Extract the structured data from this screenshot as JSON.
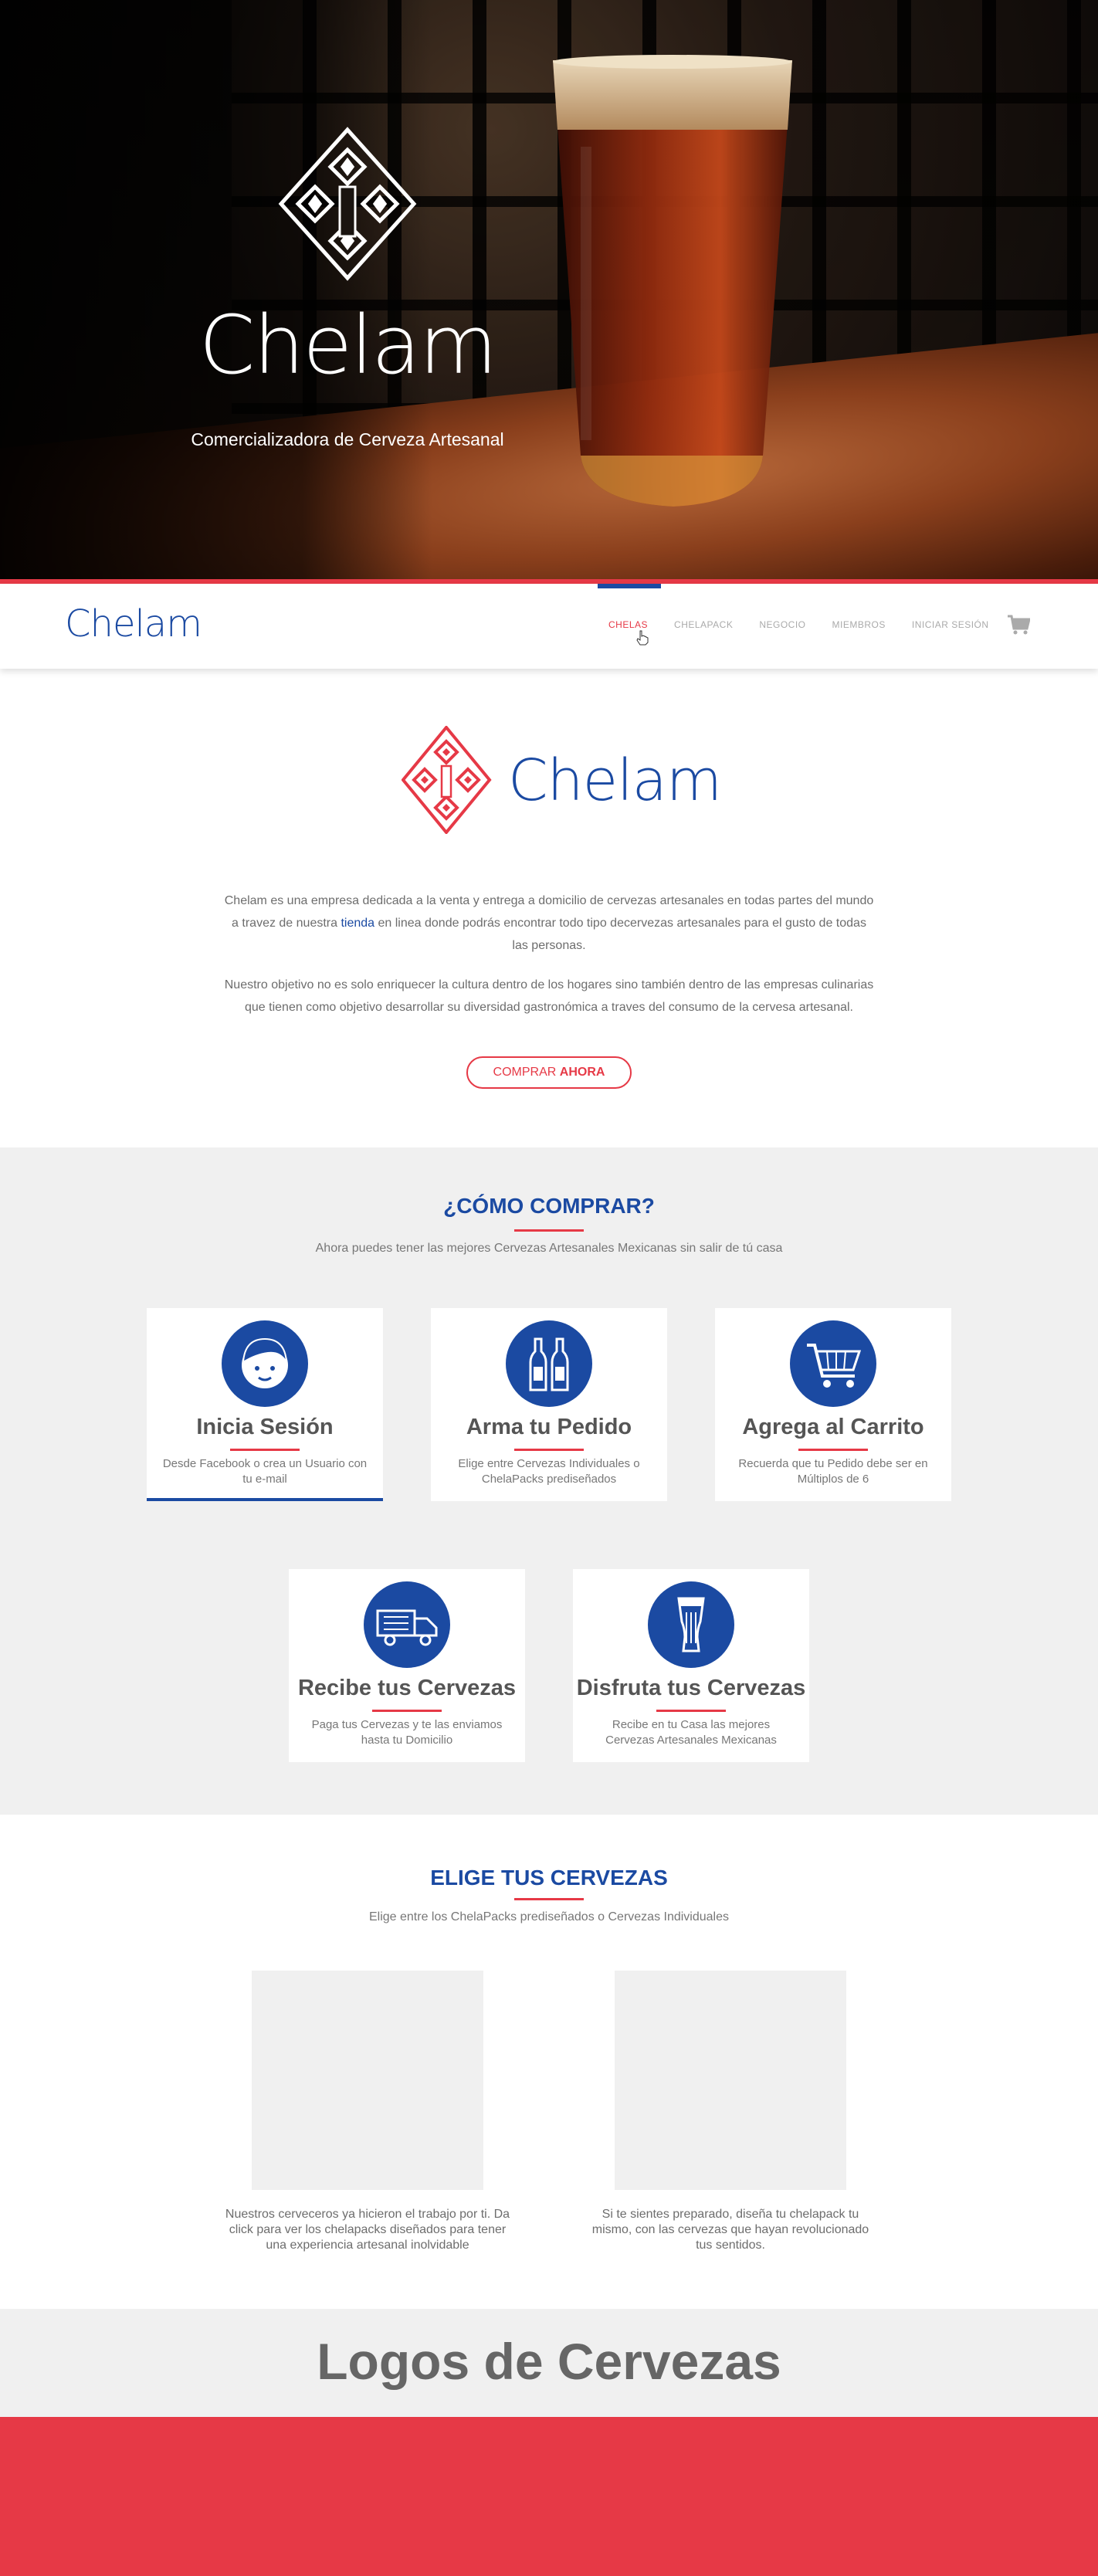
{
  "hero": {
    "brand": "Chelam",
    "tagline": "Comercializadora de Cerveza Artesanal"
  },
  "nav": {
    "brand": "Chelam",
    "items": [
      {
        "label": "CHELAS",
        "active": true
      },
      {
        "label": "CHELAPACK",
        "active": false
      },
      {
        "label": "NEGOCIO",
        "active": false
      },
      {
        "label": "MIEMBROS",
        "active": false
      },
      {
        "label": "INICIAR SESIÓN",
        "active": false
      }
    ],
    "cart_icon": "cart-icon"
  },
  "intro": {
    "brand": "Chelam",
    "p1_before": "Chelam es una empresa dedicada a la venta y entrega a domicilio de cervezas artesanales en todas partes del mundo a travez de nuestra ",
    "p1_link": "tienda",
    "p1_after": " en linea donde podrás encontrar todo tipo decervezas artesanales para el gusto de todas las personas.",
    "p2": "Nuestro objetivo no es solo enriquecer la cultura dentro de los hogares sino también dentro de las empresas culinarias que tienen como objetivo desarrollar su diversidad gastronómica a traves del consumo de la cervesa artesanal.",
    "button_light": "COMPRAR ",
    "button_bold": "AHORA"
  },
  "how": {
    "title": "¿CÓMO COMPRAR?",
    "subtitle": "Ahora puedes tener las mejores Cervezas Artesanales Mexicanas sin salir de tú casa",
    "steps": [
      {
        "title": "Inicia Sesión",
        "desc": "Desde Facebook o crea un Usuario con tu e-mail",
        "icon": "user-face-icon"
      },
      {
        "title": "Arma tu Pedido",
        "desc": "Elige entre Cervezas Individuales o ChelaPacks prediseñados",
        "icon": "beer-bottles-icon"
      },
      {
        "title": "Agrega al Carrito",
        "desc": "Recuerda que tu Pedido debe ser en Múltiplos de 6",
        "icon": "shopping-cart-icon"
      },
      {
        "title": "Recibe tus Cervezas",
        "desc": "Paga tus Cervezas y te las enviamos hasta tu Domicilio",
        "icon": "delivery-truck-icon"
      },
      {
        "title": "Disfruta tus Cervezas",
        "desc": "Recibe en tu Casa las mejores Cervezas Artesanales Mexicanas",
        "icon": "beer-glass-icon"
      }
    ]
  },
  "choose": {
    "title": "ELIGE TUS CERVEZAS",
    "subtitle": "Elige entre los ChelaPacks prediseñados o Cervezas Individuales",
    "left_desc": "Nuestros cerveceros ya hicieron el trabajo por ti. Da click para ver los chelapacks diseñados para tener una experiencia artesanal inolvidable",
    "right_desc": "Si te sientes preparado, diseña tu chelapack tu mismo, con las cervezas que hayan revolucionado tus sentidos."
  },
  "logos": {
    "title": "Logos de Cervezas"
  },
  "colors": {
    "brand_blue": "#1b4aa2",
    "accent_red": "#e63946",
    "light_gray": "#f0f0f0"
  }
}
